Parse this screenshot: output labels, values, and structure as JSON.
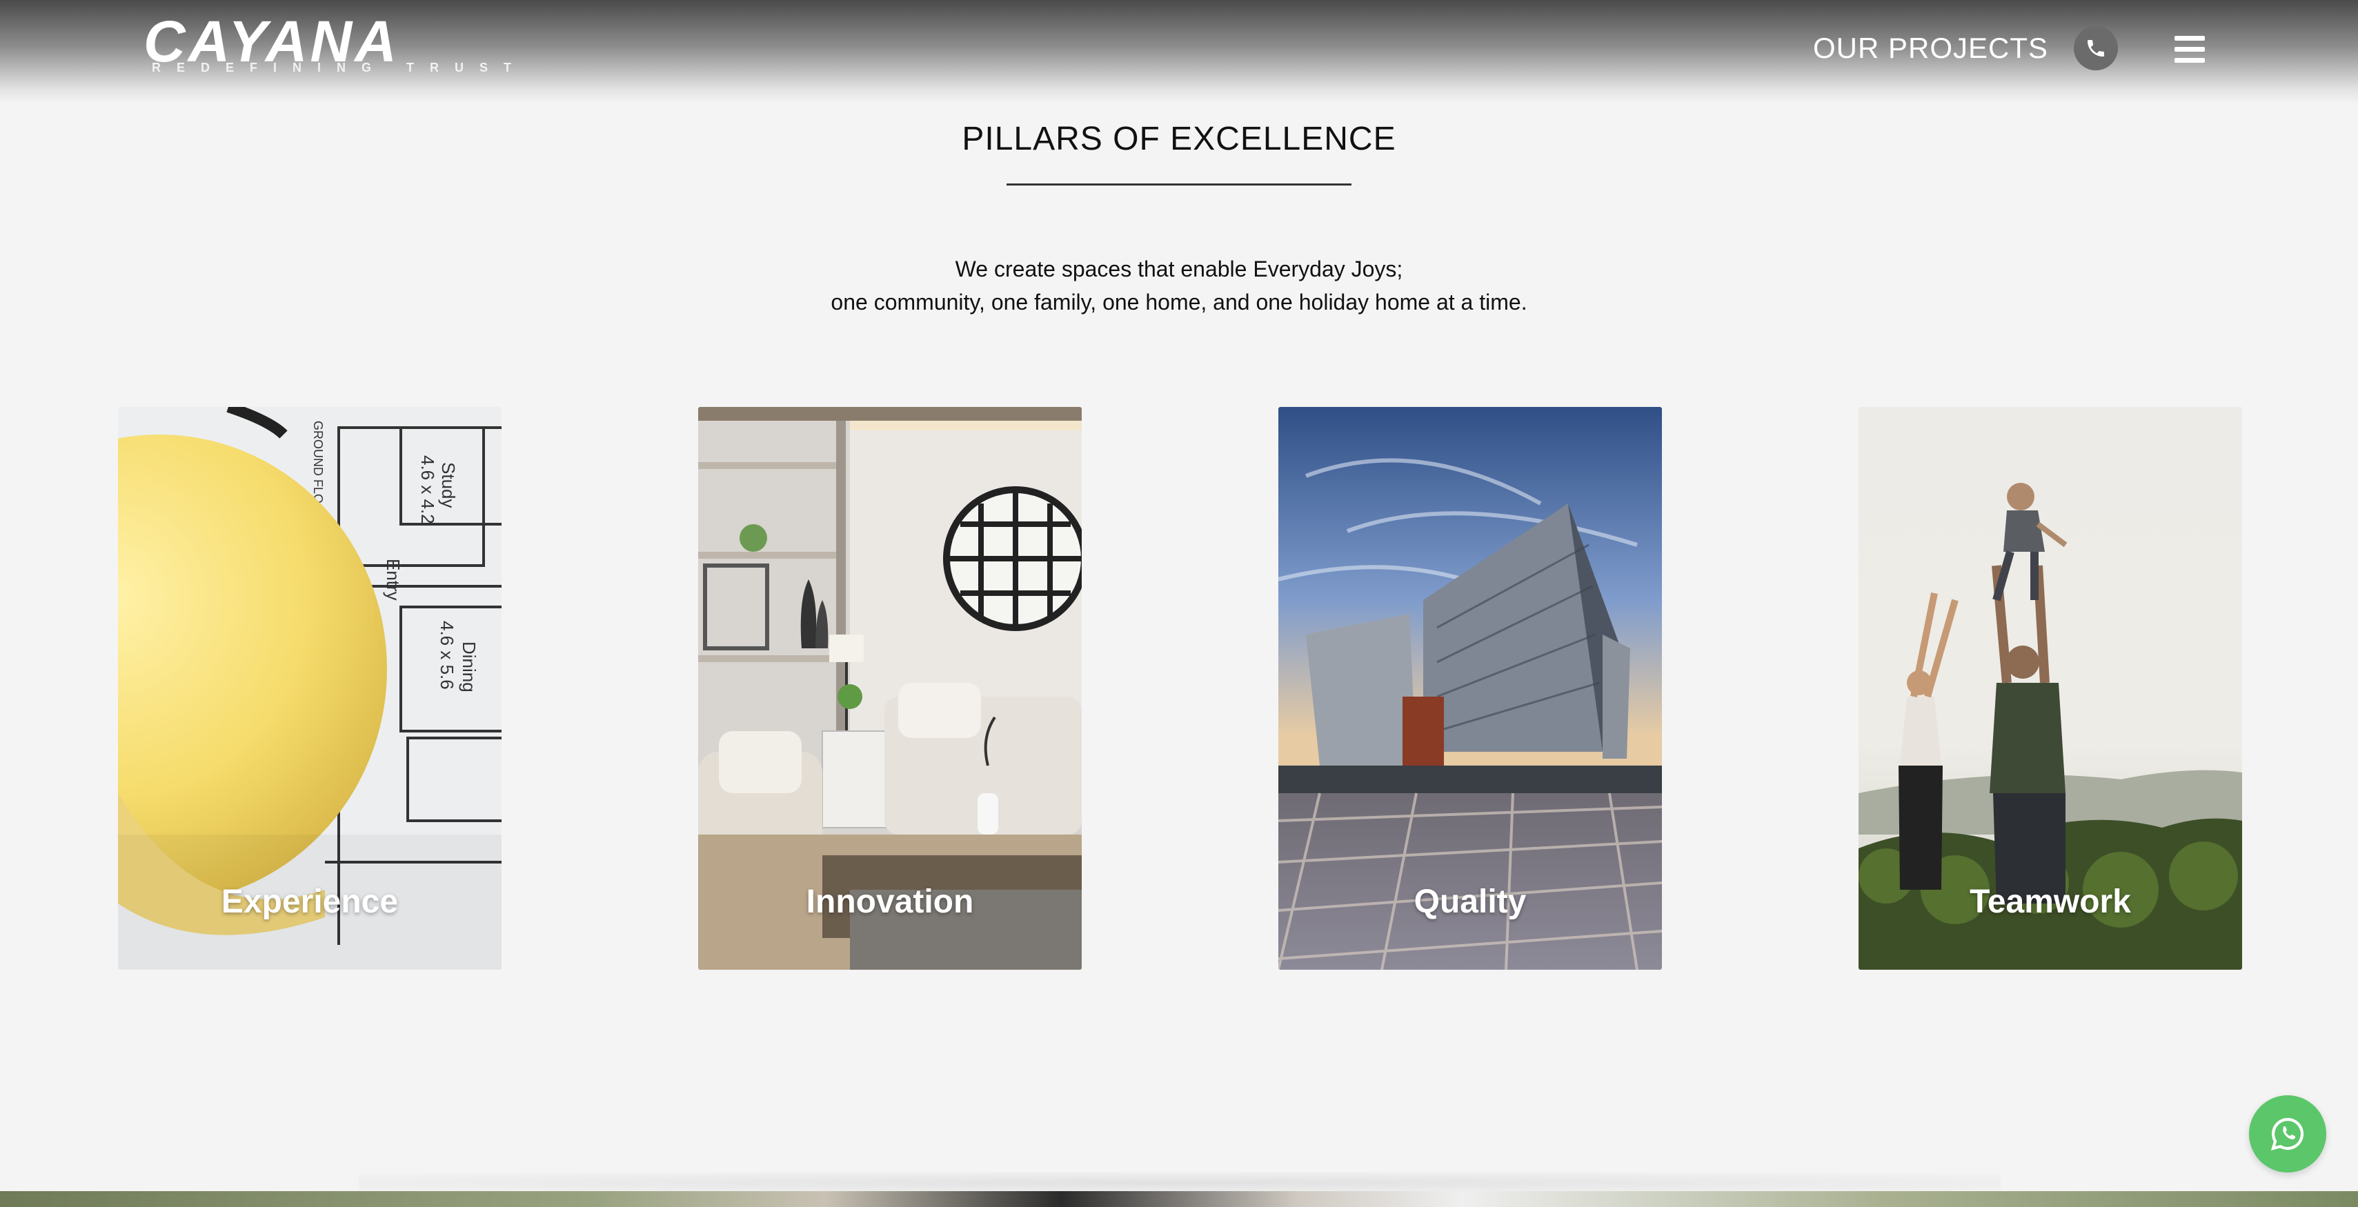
{
  "brand": {
    "name": "CAYANA",
    "tagline": "REDEFINING TRUST"
  },
  "nav": {
    "projects_label": "OUR PROJECTS",
    "phone_icon": "phone-icon",
    "menu_icon": "hamburger-menu-icon"
  },
  "section": {
    "title": "PILLARS OF EXCELLENCE",
    "intro_line1": "We create spaces that enable Everyday Joys;",
    "intro_line2": "one community, one family, one home, and one holiday home at a time."
  },
  "pillars": [
    {
      "label": "Experience"
    },
    {
      "label": "Innovation"
    },
    {
      "label": "Quality"
    },
    {
      "label": "Teamwork"
    }
  ],
  "floating": {
    "chat_icon": "whatsapp-icon",
    "chat_color": "#5cc66a"
  }
}
